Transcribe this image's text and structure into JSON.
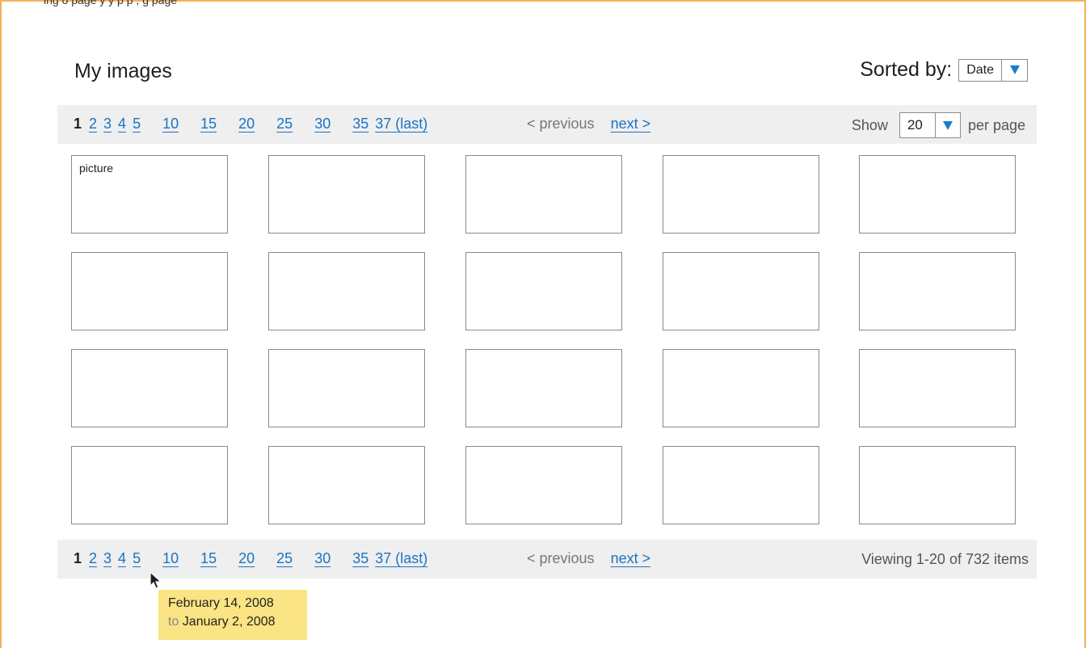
{
  "page": {
    "clipped_caption": "ing o     page    y      y      p             p         ,                            g                         page",
    "title": "My images"
  },
  "sort": {
    "label": "Sorted by:",
    "value": "Date"
  },
  "pagination": {
    "current": "1",
    "pages": [
      "2",
      "3",
      "4",
      "5",
      "10",
      "15",
      "20",
      "25",
      "30",
      "35",
      "37 (last)"
    ],
    "previous": "< previous",
    "next": "next >"
  },
  "per_page": {
    "show_label": "Show",
    "value": "20",
    "suffix": "per page"
  },
  "grid": {
    "first_label": "picture",
    "rows": 4,
    "cols": 5
  },
  "viewing": "Viewing 1-20 of 732 items",
  "tooltip": {
    "line1": "February 14, 2008",
    "to": "to",
    "line2": "January 2, 2008"
  },
  "colors": {
    "frame": "#f5b35a",
    "link": "#1a73c4",
    "bar": "#efefef",
    "tooltip": "#fae483"
  }
}
